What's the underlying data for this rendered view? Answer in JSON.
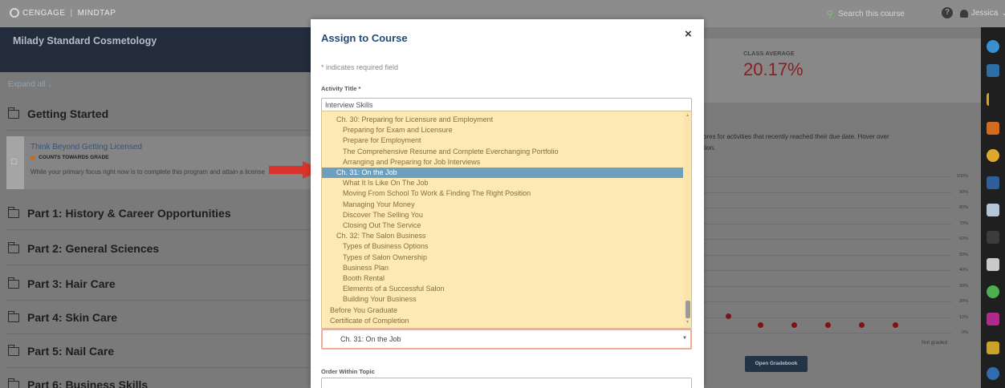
{
  "topbar": {
    "brand": "CENGAGE",
    "product": "MINDTAP",
    "search_placeholder": "Search this course",
    "user": "Jessica"
  },
  "course": {
    "title": "Milady Standard Cosmetology",
    "expand_all": "Expand all",
    "modules": [
      "Getting Started",
      "Part 1: History & Career Opportunities",
      "Part 2: General Sciences",
      "Part 3: Hair Care",
      "Part 4: Skin Care",
      "Part 5: Nail Care",
      "Part 6: Business Skills"
    ],
    "activity": {
      "title": "Think Beyond Getting Licensed",
      "badge": "COUNTS TOWARDS GRADE",
      "description": "While your primary focus right now is to complete this program and attain a license"
    }
  },
  "dashboard": {
    "class_average_label": "CLASS AVERAGE",
    "class_average_value": "20.17%",
    "help_text_line1": "ores for activities that recently reached their due date. Hover over",
    "help_text_line2": "tion.",
    "y_ticks": [
      "100%",
      "90%",
      "80%",
      "70%",
      "60%",
      "50%",
      "40%",
      "30%",
      "20%",
      "10%",
      "0%"
    ],
    "not_graded": "Not graded",
    "gradebook_button": "Open Gradebook",
    "colors": {
      "dot": "#7a1416",
      "average": "#8c1f21"
    }
  },
  "modal": {
    "title": "Assign to Course",
    "close": "×",
    "required_note": "* indicates required field",
    "activity_title_label": "Activity Title *",
    "activity_title_value": "Interview Skills",
    "dropdown_options": [
      {
        "label": "Ch. 30: Preparing for Licensure and Employment",
        "level": 1
      },
      {
        "label": "Preparing for Exam and Licensure",
        "level": 2
      },
      {
        "label": "Prepare for Employment",
        "level": 2
      },
      {
        "label": "The Comprehensive Resume and Complete Everchanging Portfolio",
        "level": 2
      },
      {
        "label": "Arranging and Preparing for Job Interviews",
        "level": 2
      },
      {
        "label": "Ch. 31: On the Job",
        "level": 1,
        "selected": true
      },
      {
        "label": "What It Is Like On The Job",
        "level": 2
      },
      {
        "label": "Moving From School To Work & Finding The Right Position",
        "level": 2
      },
      {
        "label": "Managing Your Money",
        "level": 2
      },
      {
        "label": "Discover The Selling You",
        "level": 2
      },
      {
        "label": "Closing Out The Service",
        "level": 2
      },
      {
        "label": "Ch. 32: The Salon Business",
        "level": 1
      },
      {
        "label": "Types of Business Options",
        "level": 2
      },
      {
        "label": "Types of Salon Ownership",
        "level": 2
      },
      {
        "label": "Business Plan",
        "level": 2
      },
      {
        "label": "Booth Rental",
        "level": 2
      },
      {
        "label": "Elements of a Successful Salon",
        "level": 2
      },
      {
        "label": "Building Your Business",
        "level": 2
      },
      {
        "label": "Before You Graduate",
        "level": 0
      },
      {
        "label": "Certificate of Completion",
        "level": 0
      }
    ],
    "selected_value": "Ch. 31: On the Job",
    "order_label": "Order Within Topic",
    "dropdown_colors": {
      "bg": "#fde9b3",
      "selected": "#6d9fc1",
      "arrow": "#d9342b"
    }
  }
}
